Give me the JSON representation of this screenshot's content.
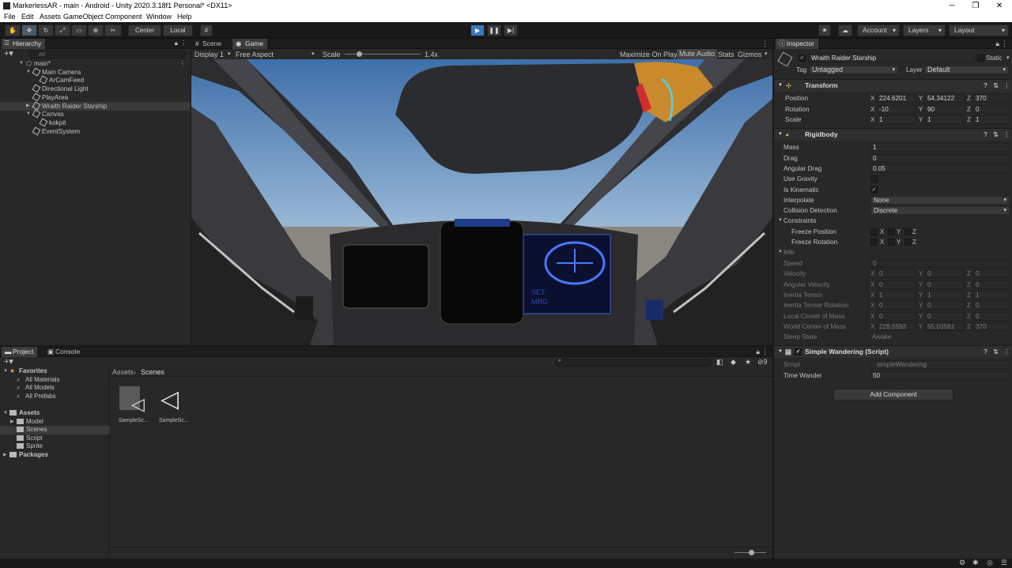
{
  "window": {
    "title": "MarkerlessAR - main - Android - Unity 2020.3.18f1 Personal* <DX11>"
  },
  "menu": [
    "File",
    "Edit",
    "Assets",
    "GameObject",
    "Component",
    "Window",
    "Help"
  ],
  "toolbar": {
    "center_label": "Center",
    "local_label": "Local",
    "account_label": "Account",
    "layers_label": "Layers",
    "layout_label": "Layout"
  },
  "hierarchy": {
    "tab": "Hierarchy",
    "search_placeholder": "All",
    "items": [
      {
        "label": "main*",
        "depth": 0
      },
      {
        "label": "Main Camera",
        "depth": 1
      },
      {
        "label": "ArCamFeed",
        "depth": 2
      },
      {
        "label": "Directional Light",
        "depth": 1
      },
      {
        "label": "PlayArea",
        "depth": 1
      },
      {
        "label": "Wraith Raider Starship",
        "depth": 1,
        "selected": true
      },
      {
        "label": "Canvas",
        "depth": 1
      },
      {
        "label": "kokpit",
        "depth": 2
      },
      {
        "label": "EventSystem",
        "depth": 1
      }
    ]
  },
  "game": {
    "tab_scene": "Scene",
    "tab_game": "Game",
    "display": "Display 1",
    "aspect": "Free Aspect",
    "scale_label": "Scale",
    "scale_value": "1.4x",
    "maximize": "Maximize On Play",
    "mute": "Mute Audio",
    "stats": "Stats",
    "gizmos": "Gizmos",
    "hud_set": "SET",
    "hud_mrg": "MRG"
  },
  "inspector": {
    "tab": "Inspector",
    "object_name": "Wraith Raider Starship",
    "static_label": "Static",
    "tag_label": "Tag",
    "tag_value": "Untagged",
    "layer_label": "Layer",
    "layer_value": "Default",
    "transform": {
      "title": "Transform",
      "position": {
        "label": "Position",
        "x": "224.6201",
        "y": "54.34122",
        "z": "370"
      },
      "rotation": {
        "label": "Rotation",
        "x": "-10",
        "y": "90",
        "z": "0"
      },
      "scale": {
        "label": "Scale",
        "x": "1",
        "y": "1",
        "z": "1"
      }
    },
    "rigidbody": {
      "title": "Rigidbody",
      "mass_label": "Mass",
      "mass": "1",
      "drag_label": "Drag",
      "drag": "0",
      "angular_drag_label": "Angular Drag",
      "angular_drag": "0.05",
      "use_gravity_label": "Use Gravity",
      "is_kinematic_label": "Is Kinematic",
      "interpolate_label": "Interpolate",
      "interpolate": "None",
      "collision_label": "Collision Detection",
      "collision": "Discrete",
      "constraints_label": "Constraints",
      "freeze_pos_label": "Freeze Position",
      "freeze_rot_label": "Freeze Rotation",
      "info_label": "Info",
      "speed_label": "Speed",
      "speed": "0",
      "velocity_label": "Velocity",
      "velocity": {
        "x": "0",
        "y": "0",
        "z": "0"
      },
      "ang_vel_label": "Angular Velocity",
      "ang_vel": {
        "x": "0",
        "y": "0",
        "z": "0"
      },
      "inertia_label": "Inertia Tensor",
      "inertia": {
        "x": "1",
        "y": "1",
        "z": "1"
      },
      "inertia_rot_label": "Inertia Tensor Rotation",
      "inertia_rot": {
        "x": "0",
        "y": "0",
        "z": "0"
      },
      "local_com_label": "Local Center of Mass",
      "local_com": {
        "x": "0",
        "y": "0",
        "z": "0"
      },
      "world_com_label": "World Center of Mass",
      "world_com": {
        "x": "228.5593",
        "y": "55.03581",
        "z": "370"
      },
      "sleep_label": "Sleep State",
      "sleep": "Awake"
    },
    "script": {
      "title": "Simple Wandering (Script)",
      "script_label": "Script",
      "script_value": "simpleWandering",
      "time_label": "Time Wander",
      "time_value": "50"
    },
    "add_component": "Add Component"
  },
  "project": {
    "tab_project": "Project",
    "tab_console": "Console",
    "favorites_label": "Favorites",
    "favorites": [
      "All Materials",
      "All Models",
      "All Prefabs"
    ],
    "assets_label": "Assets",
    "assets": [
      "Model",
      "Scenes",
      "Script",
      "Sprite"
    ],
    "packages_label": "Packages",
    "breadcrumb_root": "Assets",
    "breadcrumb_current": "Scenes",
    "files": [
      "SampleSc...",
      "SampleSc..."
    ],
    "hidden_count": "9"
  }
}
